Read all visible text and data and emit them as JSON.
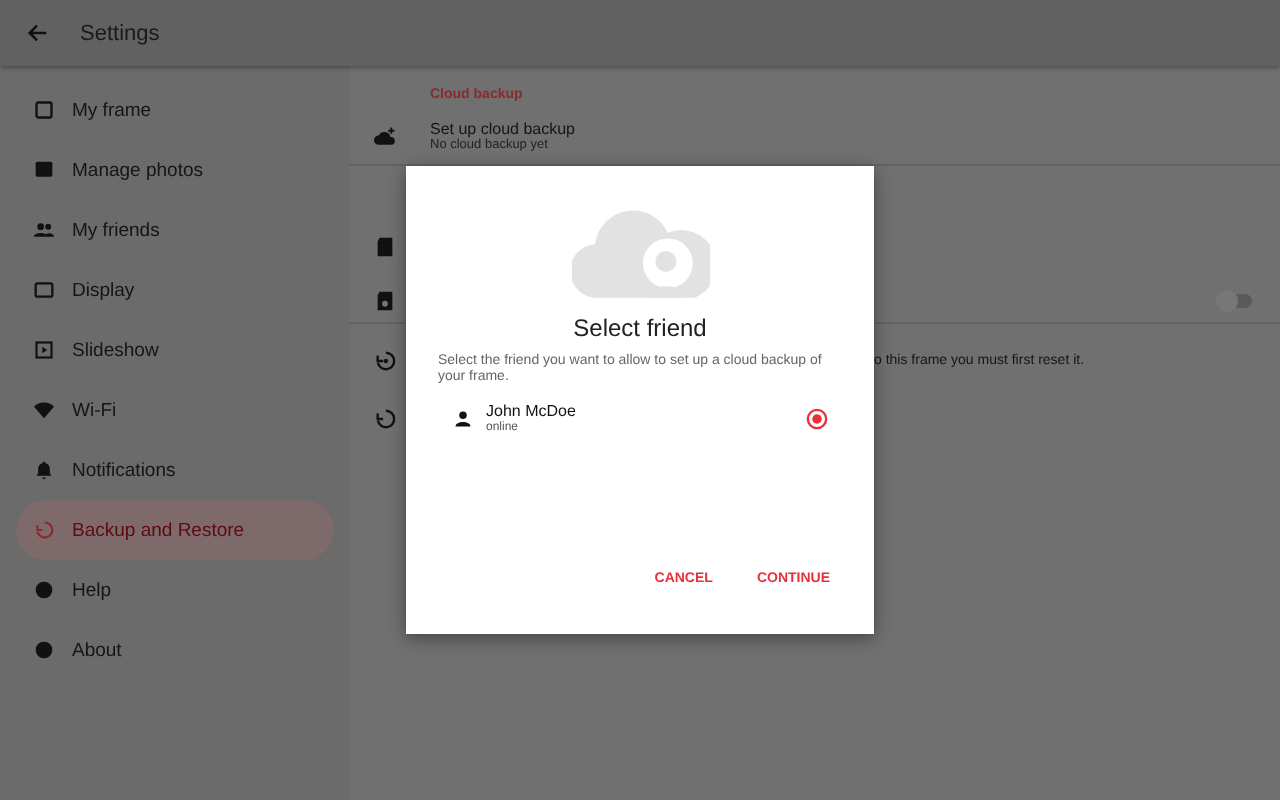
{
  "app_bar": {
    "title": "Settings"
  },
  "sidebar": {
    "items": [
      {
        "label": "My frame",
        "selected": false
      },
      {
        "label": "Manage photos",
        "selected": false
      },
      {
        "label": "My friends",
        "selected": false
      },
      {
        "label": "Display",
        "selected": false
      },
      {
        "label": "Slideshow",
        "selected": false
      },
      {
        "label": "Wi-Fi",
        "selected": false
      },
      {
        "label": "Notifications",
        "selected": false
      },
      {
        "label": "Backup and Restore",
        "selected": true
      },
      {
        "label": "Help",
        "selected": false
      },
      {
        "label": "About",
        "selected": false
      }
    ]
  },
  "content": {
    "section_title": "Cloud backup",
    "backup_row": {
      "title": "Set up cloud backup",
      "subtitle": "No cloud backup yet"
    },
    "toggle": {
      "on": false
    },
    "partial_text": "o this frame you must first reset it."
  },
  "dialog": {
    "title": "Select friend",
    "description": "Select the friend you want to allow to set up a cloud backup of your frame.",
    "friends": [
      {
        "name": "John McDoe",
        "status": "online",
        "selected": true
      }
    ],
    "buttons": [
      "CANCEL",
      "CONTINUE"
    ]
  }
}
